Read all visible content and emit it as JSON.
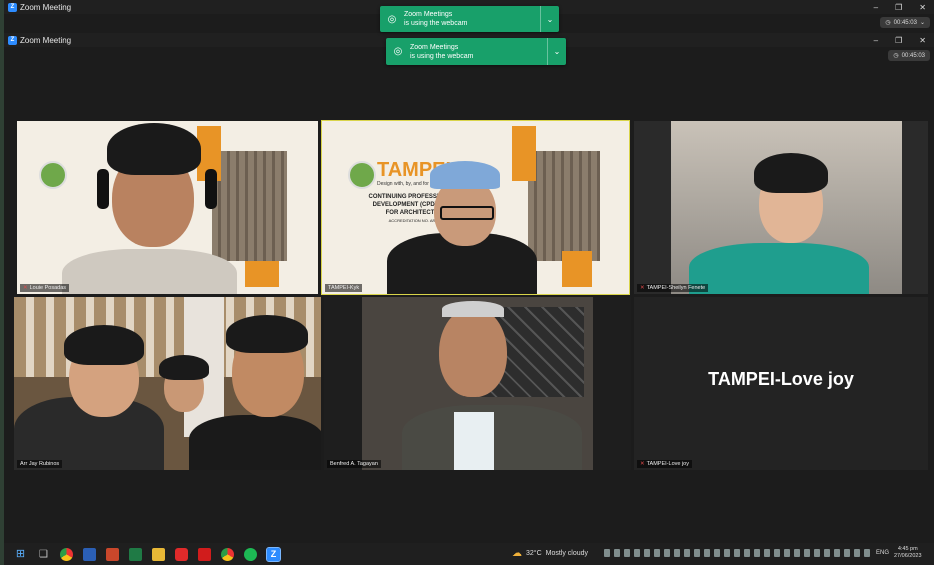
{
  "windows": [
    {
      "title": "Zoom Meeting",
      "timer": "00:45:03"
    },
    {
      "title": "Zoom Meeting",
      "timer": "00:45:03"
    }
  ],
  "notifications": [
    {
      "line1": "Zoom Meetings",
      "line2": "is using the webcam"
    },
    {
      "line1": "Zoom Meetings",
      "line2": "is using the webcam"
    }
  ],
  "window_controls": {
    "minimize": "–",
    "restore": "❐",
    "close": "✕"
  },
  "participants": [
    {
      "name": "Louie Posadas",
      "muted": true
    },
    {
      "name": "TAMPEI-Kyk",
      "muted": false,
      "active_speaker": true
    },
    {
      "name": "TAMPEI-Sheilyn Fenete",
      "muted": true
    },
    {
      "name": "Arr Jay Rubinos",
      "muted": false
    },
    {
      "name": "Benfred A. Tagayan",
      "muted": false
    },
    {
      "name": "TAMPEI-Love joy",
      "muted": true,
      "video_off_label": "TAMPEI-Love joy"
    }
  ],
  "slide": {
    "brand": "TAMPEI",
    "tagline": "Design with, by, and for the",
    "heading_lines": [
      "CONTINUING PROFESSIONAL",
      "DEVELOPMENT (CPD) PRO",
      "FOR ARCHITECTS"
    ],
    "sub": "ACCREDITATION NO. AR"
  },
  "taskbar": {
    "weather_temp": "32°C",
    "weather_desc": "Mostly cloudy",
    "language": "ENG",
    "time": "4:45 pm",
    "date": "27/06/2023",
    "apps": [
      "start-icon",
      "task-view-icon",
      "chrome-icon",
      "word-icon",
      "powerpoint-icon",
      "excel-icon",
      "file-explorer-icon",
      "youtube-icon",
      "acrobat-icon",
      "chrome-icon",
      "spotify-icon",
      "zoom-icon"
    ]
  },
  "colors": {
    "zoom_green": "#18a06a",
    "active_speaker_border": "#d9d44a",
    "tampei_orange": "#e89426"
  }
}
